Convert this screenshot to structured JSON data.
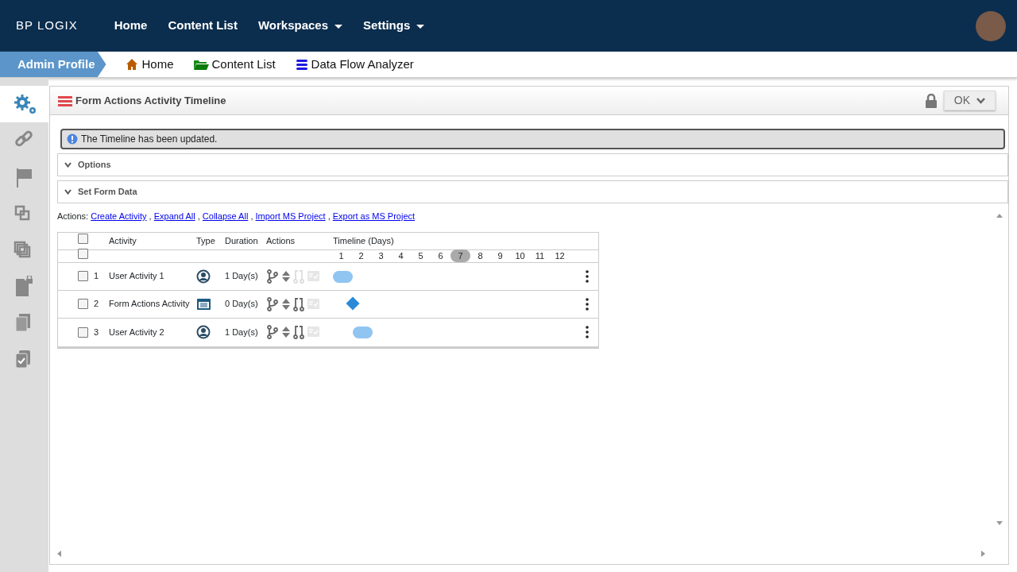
{
  "navbar": {
    "brand": "BP LOGIX",
    "items": [
      {
        "label": "Home",
        "dropdown": false
      },
      {
        "label": "Content List",
        "dropdown": false
      },
      {
        "label": "Workspaces",
        "dropdown": true
      },
      {
        "label": "Settings",
        "dropdown": true
      }
    ]
  },
  "breadcrumb": {
    "profile": "Admin Profile",
    "links": [
      {
        "label": "Home",
        "kind": "home"
      },
      {
        "label": "Content List",
        "kind": "folder"
      },
      {
        "label": "Data Flow Analyzer",
        "kind": "database"
      }
    ]
  },
  "sidebar": {
    "items": [
      {
        "kind": "gears",
        "selected": true
      },
      {
        "kind": "link",
        "selected": false
      },
      {
        "kind": "flag",
        "selected": false
      },
      {
        "kind": "squares",
        "selected": false
      },
      {
        "kind": "overlap",
        "selected": false
      },
      {
        "kind": "locked-file",
        "selected": false
      },
      {
        "kind": "copies",
        "selected": false
      },
      {
        "kind": "checked-copies",
        "selected": false
      }
    ]
  },
  "panel": {
    "title": "Form Actions Activity Timeline",
    "ok_button": "OK",
    "message": "The Timeline has been updated.",
    "sections": [
      {
        "label": "Options",
        "expanded": false
      },
      {
        "label": "Set Form Data",
        "expanded": false
      }
    ],
    "actions_label": "Actions:",
    "actions_separator": ",",
    "actions": [
      "Create Activity",
      "Expand All",
      "Collapse All",
      "Import MS Project",
      "Export as MS Project"
    ],
    "table": {
      "columns": [
        "Activity",
        "Type",
        "Duration",
        "Actions",
        "Timeline (Days)"
      ],
      "header_checked": false,
      "subheader_checked": false,
      "days": [
        {
          "label": "1",
          "selected": false
        },
        {
          "label": "2",
          "selected": false
        },
        {
          "label": "3",
          "selected": false
        },
        {
          "label": "4",
          "selected": false
        },
        {
          "label": "5",
          "selected": false
        },
        {
          "label": "6",
          "selected": false
        },
        {
          "label": "7",
          "selected": true
        },
        {
          "label": "8",
          "selected": false
        },
        {
          "label": "9",
          "selected": false
        },
        {
          "label": "10",
          "selected": false
        },
        {
          "label": "11",
          "selected": false
        },
        {
          "label": "12",
          "selected": false
        }
      ],
      "rows": [
        {
          "number": "1",
          "activity": "User Activity 1",
          "kind": "user",
          "duration": "1 Day(s)",
          "checked": false,
          "link_enabled": false,
          "marker": {
            "kind": "bar"
          }
        },
        {
          "number": "2",
          "activity": "Form Actions Activity",
          "kind": "form",
          "duration": "0 Day(s)",
          "checked": false,
          "link_enabled": true,
          "marker": {
            "kind": "milestone"
          }
        },
        {
          "number": "3",
          "activity": "User Activity 2",
          "kind": "user",
          "duration": "1 Day(s)",
          "checked": false,
          "link_enabled": true,
          "marker": {
            "kind": "bar"
          }
        }
      ]
    }
  }
}
